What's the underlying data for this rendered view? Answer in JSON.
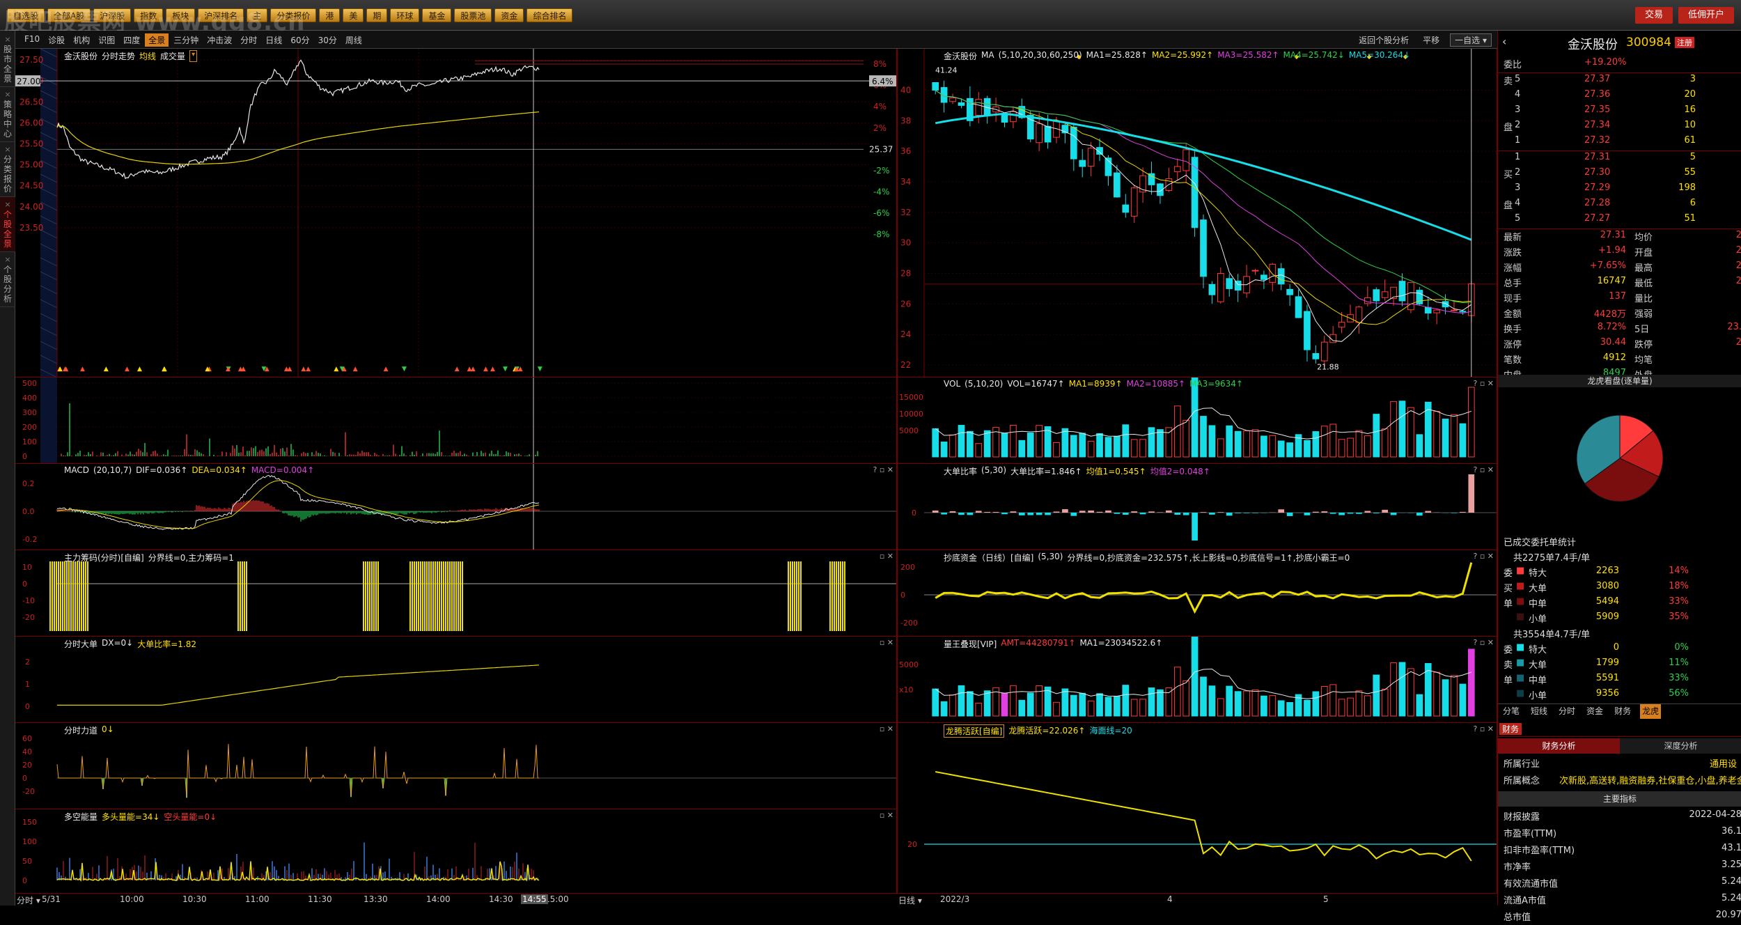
{
  "topbar": {
    "menus": [
      "自选股",
      "全部A股",
      "沪深股",
      "指数",
      "板块",
      "沪深排名",
      "主",
      "分类报价",
      "港",
      "美",
      "期",
      "环球",
      "基金",
      "股票池",
      "资金",
      "综合排名"
    ],
    "watermark": "股吧股票网 www.gg8.cn",
    "buttons": [
      "交易",
      "低佣开户"
    ]
  },
  "sidebar": [
    {
      "x": "×",
      "label": "股市全景"
    },
    {
      "x": "×",
      "label": "策略中心"
    },
    {
      "x": "×",
      "label": "分类报价"
    },
    {
      "x": "×",
      "label": "个股全景"
    },
    {
      "x": "×",
      "label": "个股分析"
    }
  ],
  "toolbar": {
    "left": [
      "F10",
      "诊股",
      "机构",
      "识图",
      "四度",
      "全景",
      "三分钟",
      "冲击波",
      "分时",
      "日线",
      "60分",
      "30分",
      "周线"
    ],
    "active": "全景",
    "right_link": "返回个股分析",
    "right_mode": "平移",
    "right_select": "一自选"
  },
  "intraday": {
    "header": {
      "name": "金沃股份",
      "title": "分时走势",
      "avg": "均线",
      "vol": "成交量"
    },
    "price_ticks": [
      "27.50",
      "27.00",
      "26.50",
      "26.00",
      "25.50",
      "25.00",
      "24.50",
      "24.00",
      "23.50"
    ],
    "current_label": "27.00",
    "pct_ticks": [
      "8%",
      "6%",
      "4%",
      "2%",
      "",
      "-2%",
      "-4%",
      "-6%",
      "-8%"
    ],
    "pct_current": "6.4%",
    "prev_close": "25.37",
    "vol_ticks": [
      "500",
      "400",
      "300",
      "200",
      "100",
      "0"
    ],
    "macd": {
      "name": "MACD",
      "params": "(20,10,7)",
      "dif": "DIF=0.036↑",
      "dea": "DEA=0.034↑",
      "macd": "MACD=0.004↑",
      "ticks": [
        "0.2",
        "0.0",
        "-0.2"
      ]
    },
    "zl": {
      "name": "主力筹码(分时)[自编]",
      "line": "分界线=0,主力筹码=1",
      "ticks": [
        "10",
        "0",
        "-10",
        "-20"
      ]
    },
    "dd": {
      "name": "分时大单",
      "dx": "DX=0↓",
      "ratio": "大单比率=1.82",
      "ticks": [
        "2",
        "1",
        "0"
      ]
    },
    "ld": {
      "name": "分时力道",
      "val": "0↓",
      "ticks": [
        "60",
        "40",
        "20",
        "0",
        "-20"
      ]
    },
    "dk": {
      "name": "多空能量",
      "dt": "多头量能=34↓",
      "kt": "空头量能=0↓",
      "ticks": [
        "150",
        "100",
        "50",
        "0"
      ]
    },
    "xaxis": {
      "mode": "分时",
      "labels": [
        "5/31",
        "10:00",
        "10:30",
        "11:00",
        "11:30",
        "13:30",
        "14:00",
        "14:30",
        "15:00"
      ],
      "cursor": "14:55"
    }
  },
  "daily": {
    "header": {
      "name": "金沃股份",
      "ma": "MA",
      "params": "(5,10,20,30,60,250)",
      "ma1": "MA1=25.828↑",
      "ma2": "MA2=25.992↑",
      "ma3": "MA3=25.582↑",
      "ma4": "MA4=25.742↓",
      "ma5": "MA5=30.264↓"
    },
    "price_ticks": [
      "40",
      "38",
      "36",
      "34",
      "32",
      "30",
      "28",
      "26",
      "24",
      "22"
    ],
    "high_label": "41.24",
    "low_label": "21.88",
    "vol": {
      "name": "VOL",
      "params": "(5,10,20)",
      "v": "VOL=16747↑",
      "ma1": "MA1=8939↑",
      "ma2": "MA2=10885↑",
      "ma3": "MA3=9634↑",
      "ticks": [
        "15000",
        "10000",
        "5000"
      ]
    },
    "dd": {
      "name": "大单比率",
      "params": "(5,30)",
      "a": "大单比率=1.846↑",
      "b": "均值1=0.545↑",
      "c": "均值2=0.048↑",
      "ticks": [
        "0"
      ]
    },
    "cd": {
      "name": "抄底资金（日线）[自编]",
      "params": "(5,30)",
      "line": "分界线=0,抄底资金=232.575↑,长上影线=0,抄底信号=1↑,抄底小霸王=0",
      "ticks": [
        "200",
        "0",
        "-200"
      ]
    },
    "lw": {
      "name": "量王叠现[VIP]",
      "amt": "AMT=44280791↑",
      "ma1": "MA1=23034522.6↑",
      "ticks": [
        "5000",
        "x10"
      ]
    },
    "lt": {
      "name": "龙腾活跃[自编]",
      "a": "龙腾活跃=22.026↑",
      "b": "海面线=20",
      "ticks": [
        "20"
      ]
    },
    "xaxis": {
      "mode": "日线",
      "labels": [
        "2022/3",
        "4",
        "5"
      ]
    }
  },
  "quote": {
    "name": "金沃股份",
    "code": "300984",
    "badge": "注册",
    "weibi_label": "委比",
    "weibi": "+19.20%",
    "sells": [
      {
        "l": "卖",
        "n": "5",
        "p": "27.37",
        "v": "3"
      },
      {
        "l": "",
        "n": "4",
        "p": "27.36",
        "v": "20"
      },
      {
        "l": "",
        "n": "3",
        "p": "27.35",
        "v": "16"
      },
      {
        "l": "盘",
        "n": "2",
        "p": "27.34",
        "v": "10"
      },
      {
        "l": "",
        "n": "1",
        "p": "27.32",
        "v": "61"
      }
    ],
    "buys": [
      {
        "l": "",
        "n": "1",
        "p": "27.31",
        "v": "5"
      },
      {
        "l": "买",
        "n": "2",
        "p": "27.30",
        "v": "55"
      },
      {
        "l": "",
        "n": "3",
        "p": "27.29",
        "v": "198"
      },
      {
        "l": "盘",
        "n": "4",
        "p": "27.28",
        "v": "6"
      },
      {
        "l": "",
        "n": "5",
        "p": "27.27",
        "v": "51"
      }
    ],
    "stats": [
      [
        "最新",
        "27.31",
        "均价",
        "2"
      ],
      [
        "涨跌",
        "+1.94",
        "开盘",
        "2"
      ],
      [
        "涨幅",
        "+7.65%",
        "最高",
        "2"
      ],
      [
        "总手",
        "16747",
        "最低",
        "2"
      ],
      [
        "现手",
        "137",
        "量比",
        ""
      ],
      [
        "金额",
        "4428万",
        "强弱",
        ""
      ],
      [
        "换手",
        "8.72%",
        "5日",
        "23."
      ],
      [
        "涨停",
        "30.44",
        "跌停",
        "2"
      ],
      [
        "笔数",
        "4912",
        "均笔",
        ""
      ],
      [
        "内盘",
        "8497",
        "外盘",
        ""
      ]
    ],
    "pie_title": "龙虎看盘(逐单量)",
    "pie_values": [
      14,
      18,
      33,
      35
    ],
    "pie_colors": [
      "#ff3b3b",
      "#c21b1b",
      "#7a0d0d",
      "#2a8a96"
    ],
    "entrust_title": "已成交委托单统计",
    "buy_total": "共2275单7.4手/单",
    "buy_rows": [
      [
        "委",
        "特大",
        "2263",
        "14%"
      ],
      [
        "买",
        "大单",
        "3080",
        "18%"
      ],
      [
        "单",
        "中单",
        "5494",
        "33%"
      ],
      [
        "",
        "小单",
        "5909",
        "35%"
      ]
    ],
    "sell_total": "共3554单4.7手/单",
    "sell_rows": [
      [
        "委",
        "特大",
        "0",
        "0%"
      ],
      [
        "卖",
        "大单",
        "1799",
        "11%"
      ],
      [
        "单",
        "中单",
        "5591",
        "33%"
      ],
      [
        "",
        "小单",
        "9356",
        "56%"
      ]
    ],
    "tabs": [
      "分笔",
      "短线",
      "分时",
      "资金",
      "财务",
      "龙虎"
    ],
    "fin_tab": "财务",
    "fin_sub": [
      "财务分析",
      "深度分析"
    ],
    "industry_label": "所属行业",
    "industry": "通用设",
    "concept_label": "所属概念",
    "concept": "次新股,高送转,融资融券,社保重仓,小盘,养老金",
    "main_title": "主要指标",
    "fin_rows": [
      [
        "财报披露",
        "2022-04-28"
      ],
      [
        "市盈率(TTM)",
        "36.1"
      ],
      [
        "扣非市盈率(TTM)",
        "43.1"
      ],
      [
        "市净率",
        "3.25"
      ],
      [
        "有效流通市值",
        "5.24"
      ],
      [
        "流通A市值",
        "5.24"
      ],
      [
        "总市值",
        "20.97"
      ]
    ]
  }
}
